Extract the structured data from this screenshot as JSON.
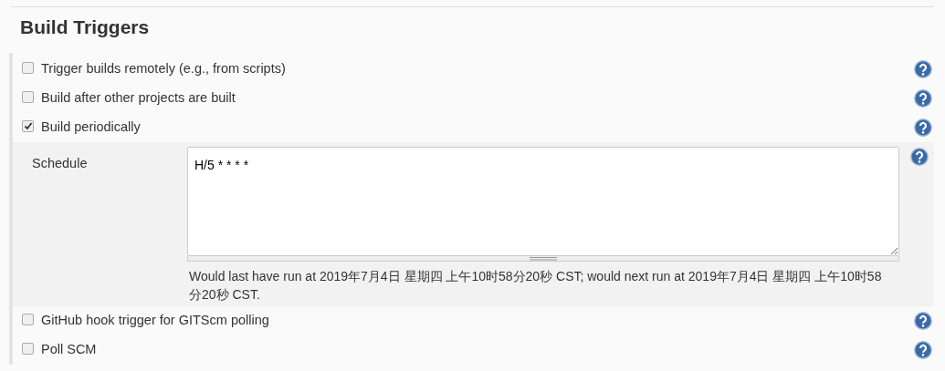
{
  "section": {
    "title": "Build Triggers"
  },
  "triggers": [
    {
      "label": "Trigger builds remotely (e.g., from scripts)",
      "checked": false
    },
    {
      "label": "Build after other projects are built",
      "checked": false
    },
    {
      "label": "Build periodically",
      "checked": true,
      "schedule": {
        "label": "Schedule",
        "value": "H/5 * * * *",
        "note": "Would last have run at 2019年7月4日 星期四 上午10时58分20秒 CST; would next run at 2019年7月4日 星期四 上午10时58分20秒 CST."
      }
    },
    {
      "label": "GitHub hook trigger for GITScm polling",
      "checked": false
    },
    {
      "label": "Poll SCM",
      "checked": false
    }
  ]
}
